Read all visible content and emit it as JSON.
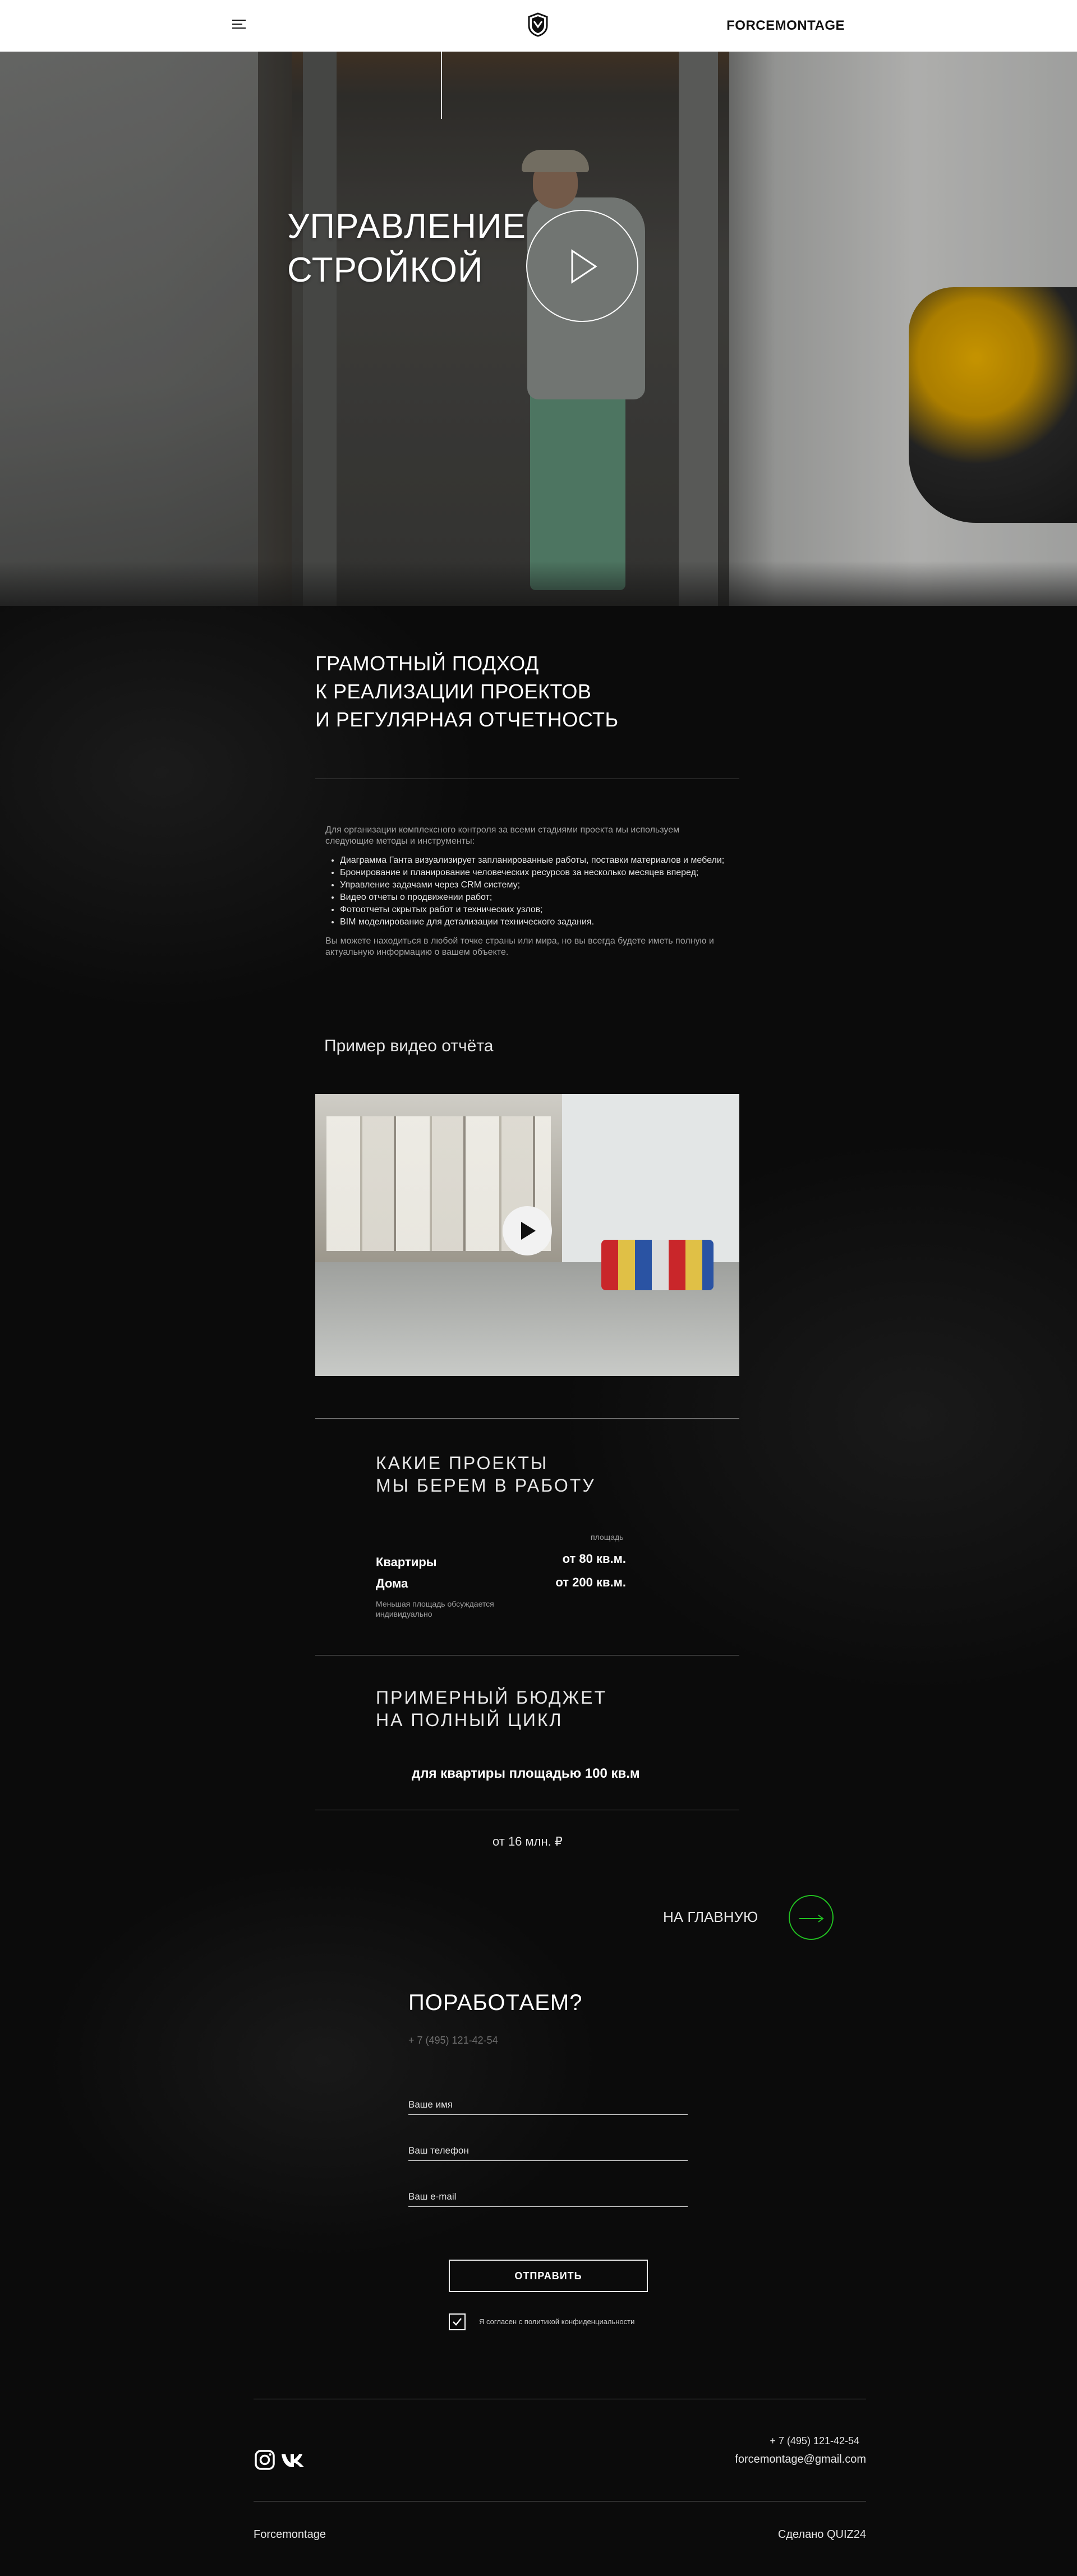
{
  "header": {
    "brand": "FORCEMONTAGE",
    "menu_icon": "hamburger-menu-icon",
    "logo_icon": "shield-logo-icon"
  },
  "hero": {
    "title_line1": "УПРАВЛЕНИЕ",
    "title_line2": "СТРОЙКОЙ",
    "play_icon": "play-icon"
  },
  "approach": {
    "title_line1": "ГРАМОТНЫЙ ПОДХОД",
    "title_line2": "К РЕАЛИЗАЦИИ ПРОЕКТОВ",
    "title_line3": "И РЕГУЛЯРНАЯ ОТЧЕТНОСТЬ",
    "intro": "Для организации комплексного контроля за всеми стадиями проекта мы используем следующие методы и инструменты:",
    "items": [
      "Диаграмма Ганта визуализирует запланированные работы, поставки материалов и мебели;",
      "Бронирование и планирование человеческих ресурсов за несколько месяцев вперед;",
      "Управление задачами через CRM систему;",
      "Видео отчеты о продвижении работ;",
      "Фотоотчеты скрытых работ и технических узлов;",
      "BIM моделирование для детализации технического задания."
    ],
    "outro": "Вы можете находиться в любой точке страны или мира, но вы всегда будете иметь полную и актуальную информацию о вашем объекте."
  },
  "video_sample": {
    "title": "Пример видео отчёта"
  },
  "projects": {
    "title_line1": "КАКИЕ ПРОЕКТЫ",
    "title_line2": "МЫ БЕРЕМ В РАБОТУ",
    "area_header": "площадь",
    "rows": [
      {
        "label": "Квартиры",
        "value": "от 80 кв.м."
      },
      {
        "label": "Дома",
        "value": "от 200 кв.м."
      }
    ],
    "note": "Меньшая площадь обсуждается индивидуально"
  },
  "budget": {
    "title_line1": "ПРИМЕРНЫЙ БЮДЖЕТ",
    "title_line2": "НА ПОЛНЫЙ ЦИКЛ",
    "subtitle": "для квартиры площадью 100 кв.м",
    "value": "от 16 млн. ₽"
  },
  "nav": {
    "home_label": "НА ГЛАВНУЮ",
    "home_icon": "arrow-right-icon",
    "accent": "#21c021"
  },
  "form": {
    "title": "ПОРАБОТАЕМ?",
    "phone": "+ 7 (495) 121-42-54",
    "name_placeholder": "Ваше имя",
    "phone_placeholder": "Ваш телефон",
    "email_placeholder": "Ваш e-mail",
    "submit_label": "ОТПРАВИТЬ",
    "consent_label": "Я согласен с политикой конфиденциальности",
    "consent_checked": true
  },
  "footer": {
    "phone": "+ 7 (495) 121-42-54",
    "email": "forcemontage@gmail.com",
    "company": "Forcemontage",
    "made_by": "Сделано QUIZ24",
    "social_icons": [
      "instagram-icon",
      "vk-icon"
    ]
  }
}
